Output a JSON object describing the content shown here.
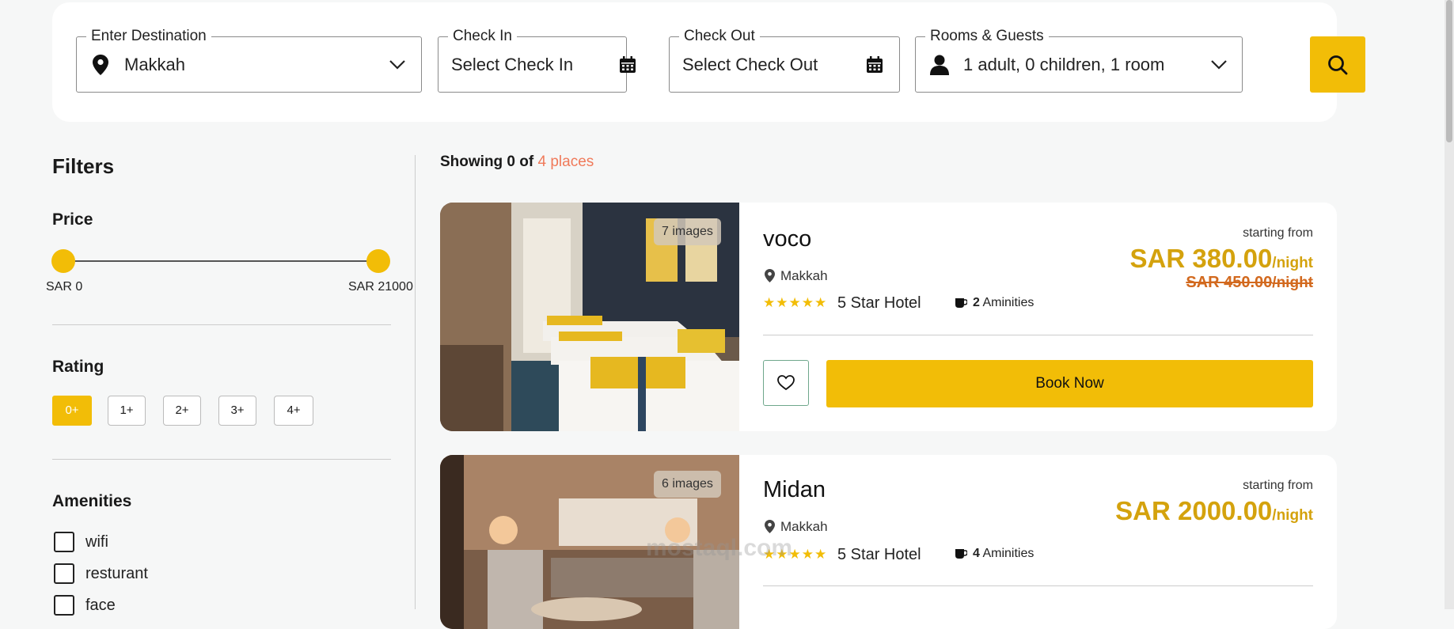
{
  "search": {
    "destination_label": "Enter Destination",
    "destination_value": "Makkah",
    "checkin_label": "Check In",
    "checkin_placeholder": "Select Check In",
    "checkout_label": "Check Out",
    "checkout_placeholder": "Select Check Out",
    "guests_label": "Rooms & Guests",
    "guests_value": "1 adult, 0 children, 1 room",
    "search_icon": "search-icon"
  },
  "filters": {
    "title": "Filters",
    "price": {
      "title": "Price",
      "min_label": "SAR 0",
      "max_label": "SAR 21000",
      "min": 0,
      "max": 21000
    },
    "rating": {
      "title": "Rating",
      "options": [
        "0+",
        "1+",
        "2+",
        "3+",
        "4+"
      ],
      "selected": "0+"
    },
    "amenities": {
      "title": "Amenities",
      "items": [
        "wifi",
        "resturant",
        "face"
      ]
    }
  },
  "results": {
    "showing_prefix": "Showing 0 of",
    "showing_count": "4 places",
    "hotels": [
      {
        "images_badge": "7 images",
        "name": "voco",
        "location": "Makkah",
        "stars": "★★★★★",
        "star_label": "5 Star Hotel",
        "amenities_count": "2",
        "amenities_label": "Aminities",
        "starting_from": "starting from",
        "price": "SAR 380.00",
        "per_night": "/night",
        "old_price": "SAR 450.00",
        "old_per_night": "/night",
        "favorite_icon": "heart-icon",
        "book_label": "Book Now"
      },
      {
        "images_badge": "6 images",
        "name": "Midan",
        "location": "Makkah",
        "stars": "★★★★★",
        "star_label": "5 Star Hotel",
        "amenities_count": "4",
        "amenities_label": "Aminities",
        "starting_from": "starting from",
        "price": "SAR 2000.00",
        "per_night": "/night"
      }
    ]
  },
  "watermark": "mostaql.com",
  "colors": {
    "accent": "#f2bd07",
    "price": "#d4a20d",
    "old_price": "#d2691e",
    "count": "#f07a5a"
  }
}
